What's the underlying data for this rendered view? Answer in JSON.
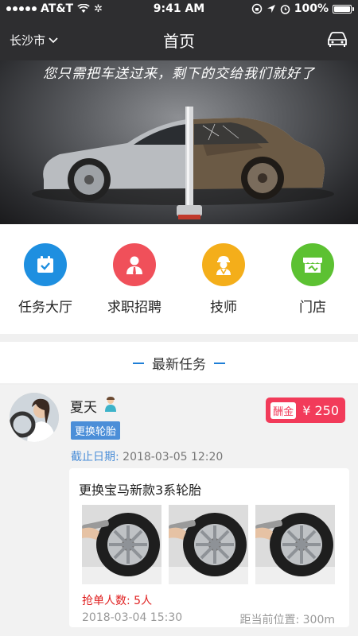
{
  "status_bar": {
    "carrier": "AT&T",
    "time": "9:41 AM",
    "battery": "100%",
    "battery_level": 1.0
  },
  "nav": {
    "city": "长沙市",
    "title": "首页"
  },
  "banner": {
    "caption": "您只需把车送过来，剩下的交给我们就好了"
  },
  "quick_menu": [
    {
      "label": "任务大厅",
      "icon": "task-calendar-icon",
      "color": "#1e8fe0"
    },
    {
      "label": "求职招聘",
      "icon": "recruit-person-icon",
      "color": "#f0505a"
    },
    {
      "label": "技师",
      "icon": "technician-icon",
      "color": "#f4ae1a"
    },
    {
      "label": "门店",
      "icon": "store-icon",
      "color": "#5cc132"
    }
  ],
  "section": {
    "title": "最新任务"
  },
  "task": {
    "user_name": "夏天",
    "tag": "更换轮胎",
    "reward_label": "酬金",
    "reward_amount": "¥ 250",
    "deadline_label": "截止日期:",
    "deadline_value": "2018-03-05 12:20",
    "title": "更换宝马新款3系轮胎",
    "grab_count": "抢单人数: 5人",
    "posted_time": "2018-03-04 15:30",
    "distance": "距当前位置: 300m"
  },
  "colors": {
    "header_bg": "#2e2e30",
    "accent_blue": "#1e7ed6",
    "reward_red": "#f23b5a"
  }
}
